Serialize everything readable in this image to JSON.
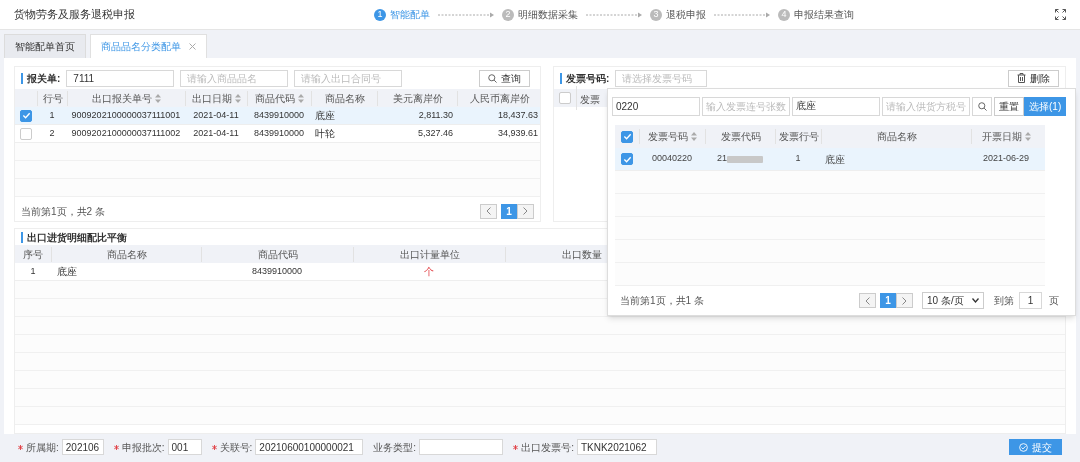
{
  "app_title": "货物劳务及服务退税申报",
  "steps": [
    {
      "number": "1",
      "label": "智能配单",
      "active": true
    },
    {
      "number": "2",
      "label": "明细数据采集",
      "active": false
    },
    {
      "number": "3",
      "label": "退税申报",
      "active": false
    },
    {
      "number": "4",
      "label": "申报结果查询",
      "active": false
    }
  ],
  "tabs": [
    {
      "label": "智能配单首页",
      "selected": false,
      "closable": false
    },
    {
      "label": "商品品名分类配单",
      "selected": true,
      "closable": true
    }
  ],
  "declaration_panel": {
    "label": "报关单:",
    "fields": [
      {
        "value": "7111"
      },
      {
        "placeholder": "请输入商品品名"
      },
      {
        "placeholder": "请输入出口合同号"
      }
    ],
    "search_button": "查询",
    "columns": [
      {
        "label": "行号",
        "sortable": false
      },
      {
        "label": "出口报关单号",
        "sortable": true
      },
      {
        "label": "出口日期",
        "sortable": true
      },
      {
        "label": "商品代码",
        "sortable": true
      },
      {
        "label": "商品名称",
        "sortable": false
      },
      {
        "label": "美元离岸价",
        "sortable": false
      },
      {
        "label": "人民币离岸价",
        "sortable": false
      }
    ],
    "rows": [
      {
        "checked": true,
        "selected": true,
        "cells": [
          "1",
          "9009202100000037111001",
          "2021-04-11",
          "8439910000",
          "底座",
          "2,811.30",
          "18,437.63"
        ]
      },
      {
        "checked": false,
        "selected": false,
        "cells": [
          "2",
          "9009202100000037111002",
          "2021-04-11",
          "8439910000",
          "叶轮",
          "5,327.46",
          "34,939.61"
        ]
      }
    ],
    "pagination_text": "当前第1页，共2 条",
    "current_page": "1"
  },
  "invoice_panel": {
    "label": "发票号码:",
    "field": {
      "placeholder": "请选择发票号码"
    },
    "delete_button": "删除",
    "header_checked": false,
    "columns": [
      {
        "label": "发票"
      }
    ]
  },
  "invoice_popup": {
    "fields": [
      {
        "value": "0220"
      },
      {
        "placeholder": "输入发票连号张数"
      },
      {
        "value": "底座"
      },
      {
        "placeholder": "请输入供货方税号"
      }
    ],
    "reset_button": "重置",
    "select_button": "选择(1)",
    "header_checked": true,
    "columns": [
      {
        "label": "发票号码",
        "sortable": true
      },
      {
        "label": "发票代码",
        "sortable": false
      },
      {
        "label": "发票行号",
        "sortable": false
      },
      {
        "label": "商品名称",
        "sortable": false
      },
      {
        "label": "开票日期",
        "sortable": true
      }
    ],
    "rows": [
      {
        "checked": true,
        "selected": true,
        "cells": [
          "00040220",
          "21",
          "1",
          "底座",
          "2021-06-29"
        ],
        "blurred": [
          false,
          true,
          false,
          false,
          false
        ]
      }
    ],
    "pagination_text": "当前第1页，共1 条",
    "current_page": "1",
    "page_size": "10 条/页",
    "goto_label": "到第",
    "goto_value": "1",
    "goto_unit": "页"
  },
  "balance_panel": {
    "title": "出口进货明细配比平衡",
    "columns": [
      {
        "label": "序号"
      },
      {
        "label": "商品名称"
      },
      {
        "label": "商品代码"
      },
      {
        "label": "出口计量单位"
      },
      {
        "label": "出口数量"
      }
    ],
    "rows": [
      {
        "cells": [
          "1",
          "底座",
          "8439910000",
          "个"
        ]
      }
    ]
  },
  "footer": {
    "fields": [
      {
        "label": "所属期:",
        "required": true,
        "value": "202106"
      },
      {
        "label": "申报批次:",
        "required": true,
        "value": "001"
      },
      {
        "label": "关联号:",
        "required": true,
        "value": "20210600100000021"
      },
      {
        "label": "业务类型:",
        "required": false
      },
      {
        "label": "出口发票号:",
        "required": true,
        "value": "TKNK2021062"
      }
    ],
    "submit_button": "提交"
  }
}
